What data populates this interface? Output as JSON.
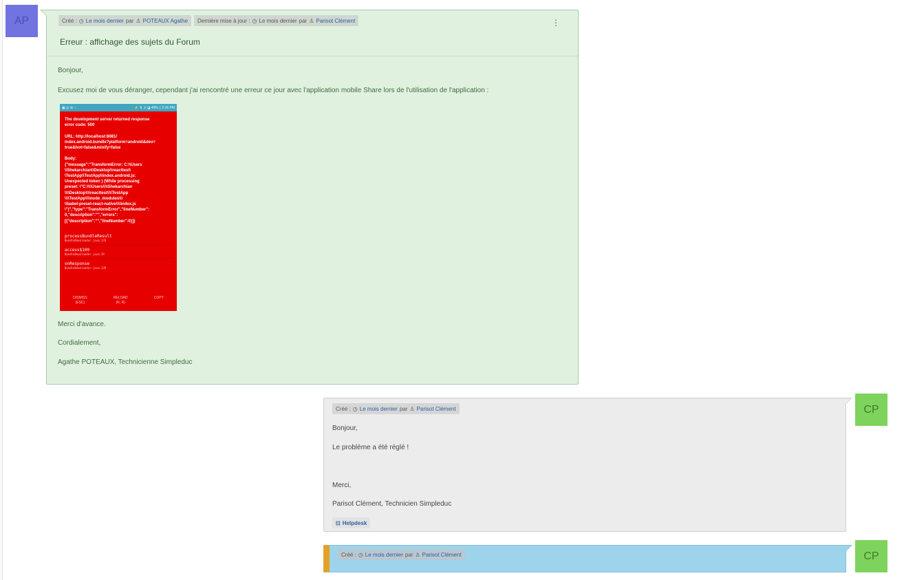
{
  "colors": {
    "message_green_bg": "#e1f1e0",
    "message_grey_bg": "#ececec",
    "message_blue_bg": "#9dd4ec",
    "accent_orange": "#e7a027",
    "avatar_ap": "#7073e0",
    "avatar_cp": "#7ed35c",
    "error_red": "#e60000"
  },
  "avatars": {
    "ap": "AP",
    "cp": "CP"
  },
  "message1": {
    "created_label": "Créé :",
    "created_when": "Le mois dernier",
    "created_by_prefix": "par",
    "created_by": "POTEAUX Agathe",
    "updated_label": "Dernière mise à jour :",
    "updated_when": "Le mois dernier",
    "updated_by_prefix": "par",
    "updated_by": "Parisot Clément",
    "title": "Erreur : affichage des sujets du Forum",
    "greeting": "Bonjour,",
    "paragraph": "Excusez moi de vous déranger, cependant j'ai rencontré une erreur ce jour avec l'application mobile Share  lors de l'utilisation de l'application :",
    "thanks": "Merci d'avance.",
    "closing": "Cordialement,",
    "signature": "Agathe POTEAUX, Technicienne Simpleduc"
  },
  "error_screenshot": {
    "status_left": "▣ ◎ ⊚ ⁙",
    "status_right": "⚡ ⇅ .ıl ◪ 49% ▯ 2:36 PM",
    "message": "The development server returned response\nerror code: 500\n\nURL: http://localhost:8081/\nindex.android.bundle?platform=android&dev=\ntrue&hot=false&minify=false\n\nBody:\n{\"message\":\"TransformError: C:\\\\Users\n\\\\Shekarchian\\\\Desktop\\\\reacttest\\\n\\TestApp\\\\TestApp\\\\index.android.js:\nUnexpected token ) (While processing\npreset: \\\"C:\\\\\\\\Users\\\\\\\\Shekarchian\n\\\\\\\\Desktop\\\\\\\\reacttest\\\\\\\\TestApp\n\\\\\\\\TestApp\\\\\\\\node_modules\\\\\\\n\\\\babel-preset-react-native\\\\\\\\index.js\n\\\")\",\"type\":\"TransformError\",\"lineNumber\":\n0,\"description\":\"\",\"errors\":\n[{\"description\":\"\",\"lineNumber\":0}]}",
    "stack": [
      {
        "fn": "processBundleResult",
        "loc": "BundleDownloader.java:178"
      },
      {
        "fn": "access$100",
        "loc": "BundleDownloader.java:39"
      },
      {
        "fn": "onResponse",
        "loc": "BundleDownloader.java:139"
      }
    ],
    "actions": {
      "dismiss": "DISMISS",
      "dismiss_key": "(ESC)",
      "reload": "RELOAD",
      "reload_key": "(R, R)",
      "copy": "COPY"
    }
  },
  "message2": {
    "created_label": "Créé :",
    "created_when": "Le mois dernier",
    "created_by_prefix": "par",
    "created_by": "Parisot Clément",
    "greeting": "Bonjour,",
    "line1": "Le problème a été réglé !",
    "thanks": "Merci,",
    "signature": "Parisot Clément, Technicien Simpleduc",
    "source_badge": "Helpdesk"
  },
  "message3": {
    "created_label": "Créé :",
    "created_when": "Le mois dernier",
    "created_by_prefix": "par",
    "created_by": "Parisot Clément"
  }
}
